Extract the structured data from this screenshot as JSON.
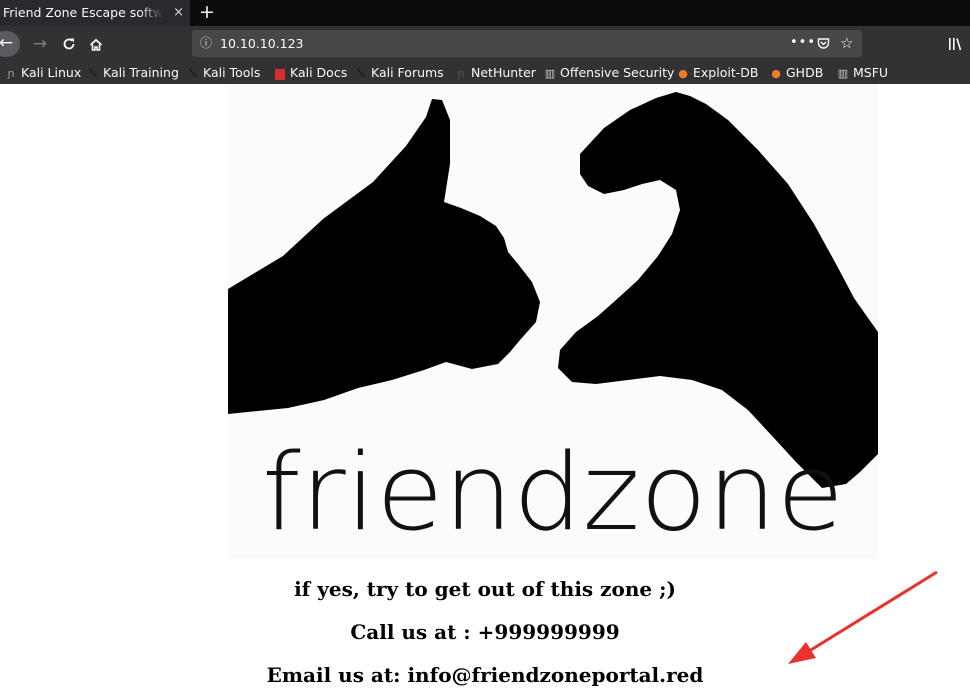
{
  "browser": {
    "tab_title": "Friend Zone Escape software",
    "tab_close": "×",
    "new_tab": "+",
    "url": "10.10.10.123",
    "icons": {
      "back": "back-arrow-icon",
      "forward": "forward-arrow-icon",
      "reload": "reload-icon",
      "home": "home-icon",
      "info": "info-icon",
      "more": "page-actions-icon",
      "pocket": "pocket-icon",
      "star": "bookmark-star-icon",
      "library": "library-icon"
    }
  },
  "bookmarks": [
    {
      "label": "Kali Linux",
      "icon": "kali-dragon-icon"
    },
    {
      "label": "Kali Training",
      "icon": "kali-dragon-icon"
    },
    {
      "label": "Kali Tools",
      "icon": "kali-dragon-icon"
    },
    {
      "label": "Kali Docs",
      "icon": "kali-docs-icon"
    },
    {
      "label": "Kali Forums",
      "icon": "kali-dragon-icon"
    },
    {
      "label": "NetHunter",
      "icon": "nethunter-icon"
    },
    {
      "label": "Offensive Security",
      "icon": "offsec-icon"
    },
    {
      "label": "Exploit-DB",
      "icon": "exploit-db-icon"
    },
    {
      "label": "GHDB",
      "icon": "exploit-db-icon"
    },
    {
      "label": "MSFU",
      "icon": "offsec-icon"
    }
  ],
  "page": {
    "logo_text": "friendzone",
    "line1": "if yes, try to get out of this zone ;)",
    "line2": "Call us at : +999999999",
    "line3": "Email us at: info@friendzoneportal.red"
  },
  "colors": {
    "annotation_arrow": "#e8322c"
  }
}
